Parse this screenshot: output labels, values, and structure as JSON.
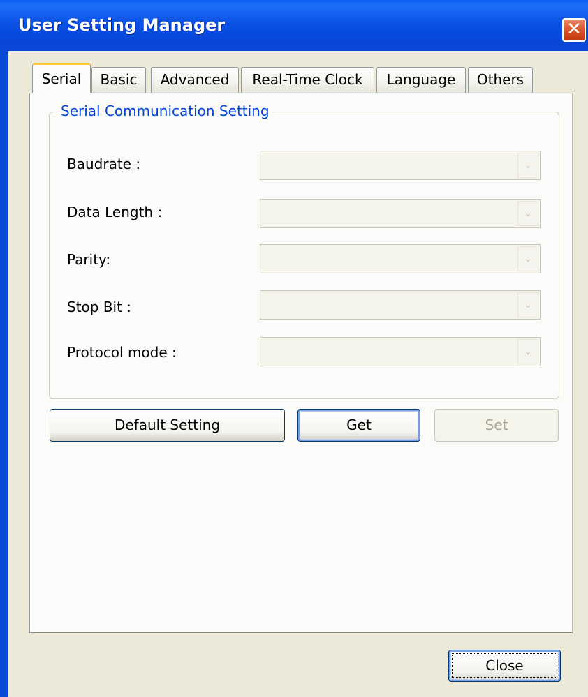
{
  "window": {
    "title": "User Setting Manager",
    "close_glyph": "✕"
  },
  "tabs": [
    {
      "label": "Serial",
      "active": true
    },
    {
      "label": "Basic",
      "active": false
    },
    {
      "label": "Advanced",
      "active": false
    },
    {
      "label": "Real-Time Clock",
      "active": false
    },
    {
      "label": "Language",
      "active": false
    },
    {
      "label": "Others",
      "active": false
    }
  ],
  "group": {
    "title": "Serial Communication Setting",
    "fields": [
      {
        "label": "Baudrate :",
        "value": ""
      },
      {
        "label": "Data Length :",
        "value": ""
      },
      {
        "label": "Parity:",
        "value": ""
      },
      {
        "label": "Stop Bit :",
        "value": ""
      },
      {
        "label": "Protocol mode :",
        "value": ""
      }
    ]
  },
  "buttons": {
    "default_setting": "Default Setting",
    "get": "Get",
    "set": "Set",
    "close": "Close"
  },
  "colors": {
    "title_bar": "#0a48d8",
    "dialog_bg": "#ece9d8",
    "group_title": "#0046d5",
    "active_tab_accent": "#ffc83c"
  }
}
